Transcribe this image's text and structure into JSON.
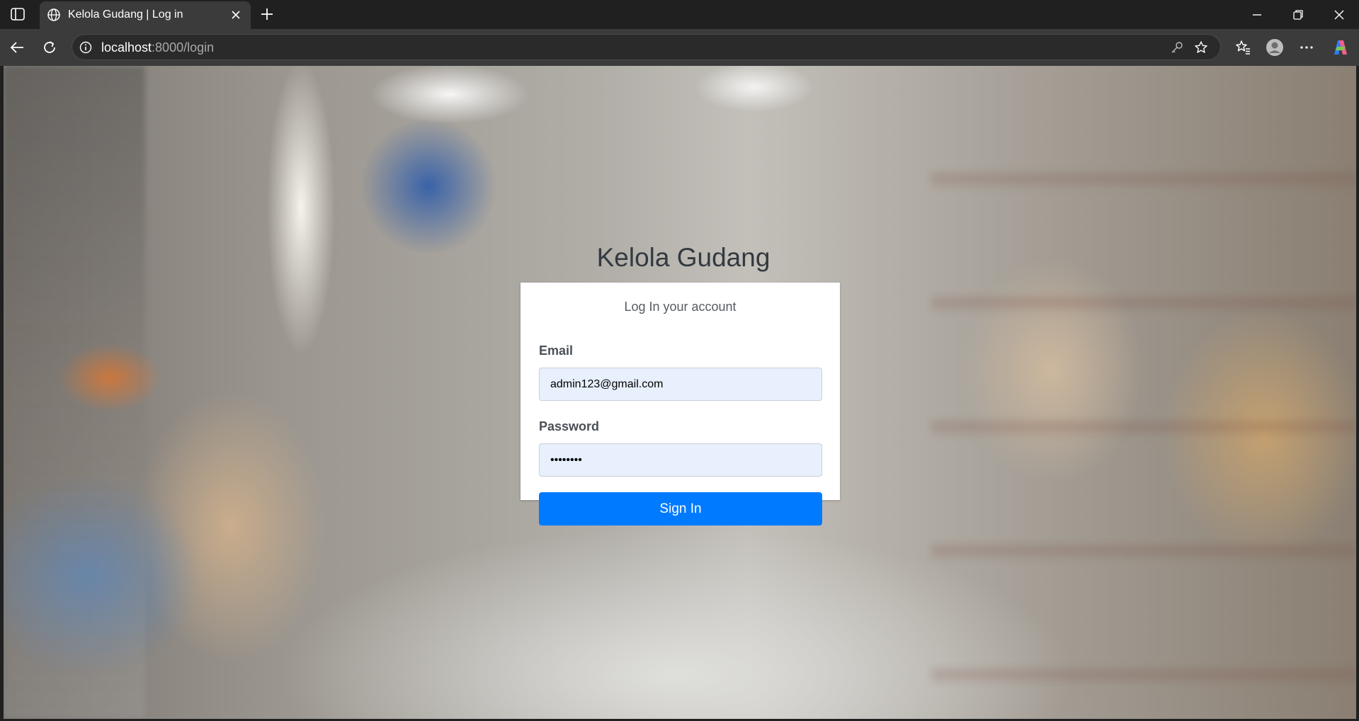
{
  "browser": {
    "tab": {
      "title": "Kelola Gudang | Log in"
    },
    "address": {
      "host": "localhost",
      "path": ":8000/login"
    }
  },
  "icons": {
    "sidebar": "sidebar-icon",
    "favicon": "globe-icon",
    "tab_close": "close-icon",
    "new_tab": "plus-icon",
    "back": "back-arrow-icon",
    "reload": "reload-icon",
    "site_info": "info-icon",
    "password_key": "key-icon",
    "favorite": "star-icon",
    "favorites": "favorites-icon",
    "profile": "profile-icon",
    "more": "more-icon",
    "copilot": "copilot-icon"
  },
  "login": {
    "title": "Kelola Gudang",
    "subtitle": "Log In your account",
    "email_label": "Email",
    "email_value": "admin123@gmail.com",
    "password_label": "Password",
    "password_value": "12345678",
    "submit_label": "Sign In"
  },
  "colors": {
    "primary": "#007bff",
    "autofill": "#e8f0fe"
  }
}
